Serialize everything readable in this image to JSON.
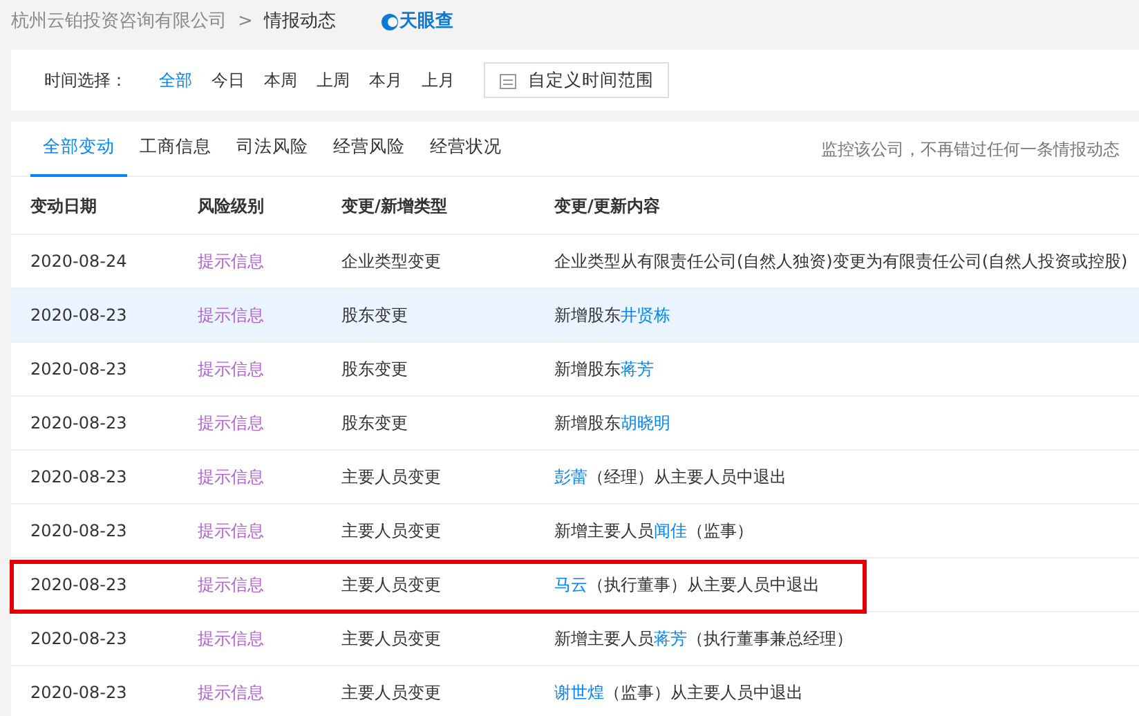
{
  "breadcrumb": {
    "company": "杭州云铂投资咨询有限公司",
    "separator": ">",
    "current": "情报动态",
    "logo": "天眼查"
  },
  "time_filter": {
    "label": "时间选择：",
    "options": [
      {
        "label": "全部",
        "selected": true
      },
      {
        "label": "今日",
        "selected": false
      },
      {
        "label": "本周",
        "selected": false
      },
      {
        "label": "上周",
        "selected": false
      },
      {
        "label": "本月",
        "selected": false
      },
      {
        "label": "上月",
        "selected": false
      }
    ],
    "custom_button": "自定义时间范围"
  },
  "tabs": [
    {
      "label": "全部变动",
      "selected": true
    },
    {
      "label": "工商信息",
      "selected": false
    },
    {
      "label": "司法风险",
      "selected": false
    },
    {
      "label": "经营风险",
      "selected": false
    },
    {
      "label": "经营状况",
      "selected": false
    }
  ],
  "monitor_note": "监控该公司，不再错过任何一条情报动态",
  "table": {
    "columns": [
      "变动日期",
      "风险级别",
      "变更/新增类型",
      "变更/更新内容"
    ],
    "rows": [
      {
        "date": "2020-08-24",
        "risk": "提示信息",
        "type": "企业类型变更",
        "content": [
          {
            "text": "企业类型从有限责任公司(自然人独资)变更为有限责任公司(自然人投资或控股)",
            "link": false
          }
        ],
        "hovered": false,
        "highlighted": false
      },
      {
        "date": "2020-08-23",
        "risk": "提示信息",
        "type": "股东变更",
        "content": [
          {
            "text": "新增股东",
            "link": false
          },
          {
            "text": "井贤栋",
            "link": true
          }
        ],
        "hovered": true,
        "highlighted": false
      },
      {
        "date": "2020-08-23",
        "risk": "提示信息",
        "type": "股东变更",
        "content": [
          {
            "text": "新增股东",
            "link": false
          },
          {
            "text": "蒋芳",
            "link": true
          }
        ],
        "hovered": false,
        "highlighted": false
      },
      {
        "date": "2020-08-23",
        "risk": "提示信息",
        "type": "股东变更",
        "content": [
          {
            "text": "新增股东",
            "link": false
          },
          {
            "text": "胡晓明",
            "link": true
          }
        ],
        "hovered": false,
        "highlighted": false
      },
      {
        "date": "2020-08-23",
        "risk": "提示信息",
        "type": "主要人员变更",
        "content": [
          {
            "text": "彭蕾",
            "link": true
          },
          {
            "text": "（经理）从主要人员中退出",
            "link": false
          }
        ],
        "hovered": false,
        "highlighted": false
      },
      {
        "date": "2020-08-23",
        "risk": "提示信息",
        "type": "主要人员变更",
        "content": [
          {
            "text": "新增主要人员",
            "link": false
          },
          {
            "text": "闻佳",
            "link": true
          },
          {
            "text": "（监事）",
            "link": false
          }
        ],
        "hovered": false,
        "highlighted": false
      },
      {
        "date": "2020-08-23",
        "risk": "提示信息",
        "type": "主要人员变更",
        "content": [
          {
            "text": "马云",
            "link": true
          },
          {
            "text": "（执行董事）从主要人员中退出",
            "link": false
          }
        ],
        "hovered": false,
        "highlighted": true
      },
      {
        "date": "2020-08-23",
        "risk": "提示信息",
        "type": "主要人员变更",
        "content": [
          {
            "text": "新增主要人员",
            "link": false
          },
          {
            "text": "蒋芳",
            "link": true
          },
          {
            "text": "（执行董事兼总经理）",
            "link": false
          }
        ],
        "hovered": false,
        "highlighted": false
      },
      {
        "date": "2020-08-23",
        "risk": "提示信息",
        "type": "主要人员变更",
        "content": [
          {
            "text": "谢世煌",
            "link": true
          },
          {
            "text": "（监事）从主要人员中退出",
            "link": false
          }
        ],
        "hovered": false,
        "highlighted": false
      }
    ]
  }
}
